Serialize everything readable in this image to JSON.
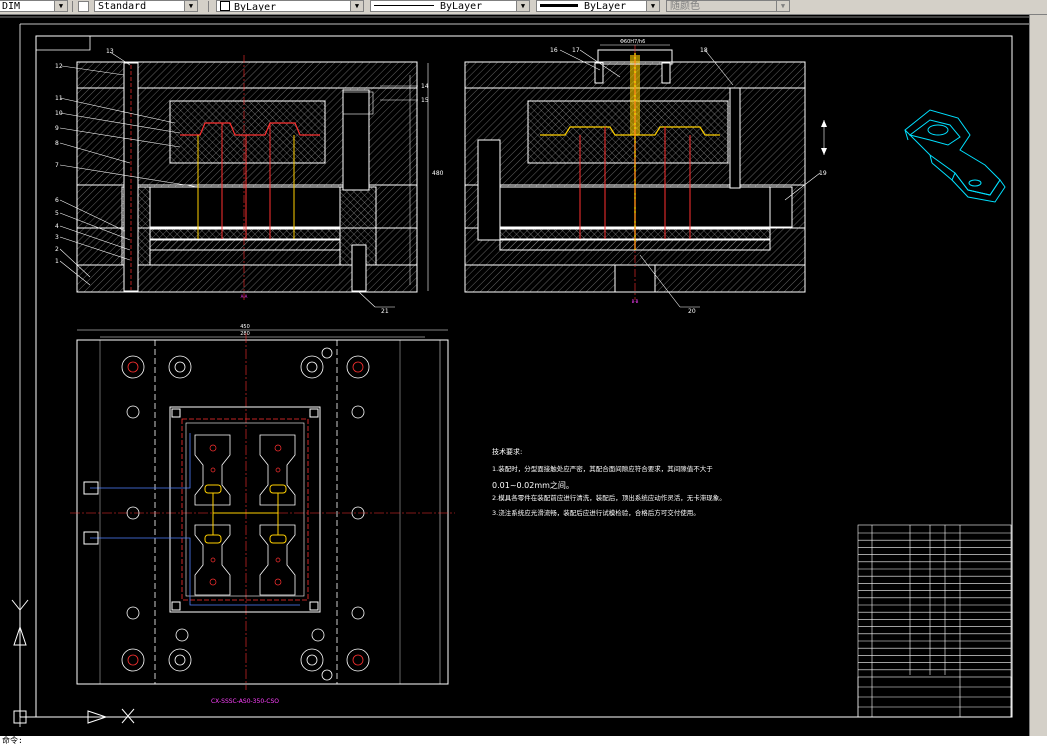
{
  "toolbar": {
    "dim_style": "DIM",
    "text_style": "Standard",
    "layer": "ByLayer",
    "linetype": "ByLayer",
    "lineweight": "ByLayer",
    "plot_style": "随颜色"
  },
  "drawing": {
    "drawing_number": "CX-SSSC-AS0-350-CSO",
    "tech_requirements_title": "技术要求:",
    "tech_requirements": [
      "1.装配时，分型面接触处应严密，其配合面间隙应符合要求，其间隙值不大于",
      "0.01~0.02mm之间。",
      "2.模具各零件在装配前应进行清洗，装配后，顶出系统应动作灵活，无卡滞现象。",
      "3.浇注系统应光滑流畅，装配后应进行试模检验，合格后方可交付使用。"
    ],
    "part_labels": [
      "1",
      "2",
      "3",
      "4",
      "5",
      "6",
      "7",
      "8",
      "9",
      "10",
      "11",
      "12",
      "13",
      "14",
      "15",
      "16",
      "17",
      "18",
      "19",
      "20",
      "21"
    ],
    "label_dim_top": "Φ60H7/h6",
    "label_dim_w": "450",
    "label_dim_w2": "280",
    "label_dim_h": "480",
    "section_mark_a": "A-A",
    "section_mark_b": "B-B"
  },
  "cmdline": {
    "prompt": "命令: "
  },
  "colors": {
    "canvas": "#000000",
    "line_white": "#ffffff",
    "hatch": "#b0b0b0",
    "accent_red": "#ff3030",
    "accent_yellow": "#ffd000",
    "accent_magenta": "#ff40ff",
    "accent_cyan": "#00e0ff"
  }
}
